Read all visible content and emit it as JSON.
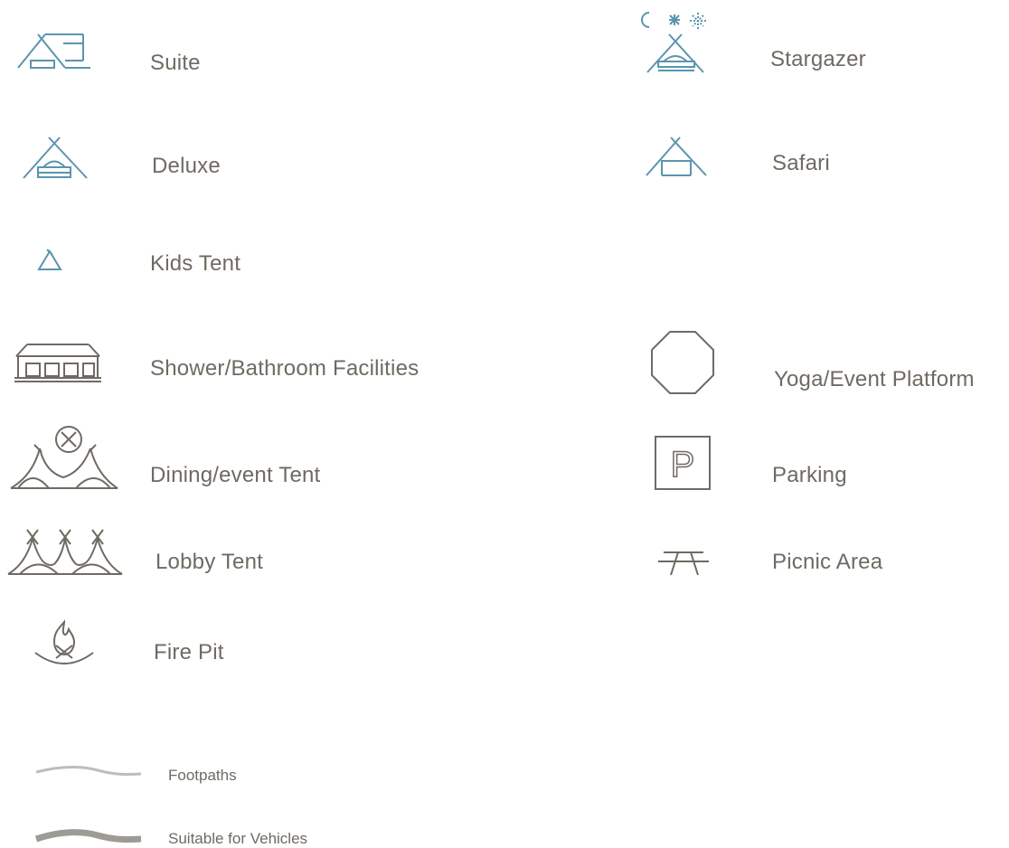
{
  "legend": {
    "left": [
      {
        "label": "Suite",
        "icon": "suite-tent-icon",
        "color": "#5a95ae"
      },
      {
        "label": "Deluxe",
        "icon": "deluxe-tent-icon",
        "color": "#5a95ae"
      },
      {
        "label": "Kids Tent",
        "icon": "kids-tent-icon",
        "color": "#5a95ae"
      },
      {
        "label": "Shower/Bathroom Facilities",
        "icon": "bathroom-building-icon",
        "color": "#6f6a62"
      },
      {
        "label": "Dining/event Tent",
        "icon": "dining-tent-icon",
        "color": "#6f6a62"
      },
      {
        "label": "Lobby Tent",
        "icon": "lobby-tent-icon",
        "color": "#6f6a62"
      },
      {
        "label": "Fire Pit",
        "icon": "fire-pit-icon",
        "color": "#6f6a62"
      }
    ],
    "right": [
      {
        "label": "Stargazer",
        "icon": "stargazer-tent-icon",
        "color": "#5a95ae"
      },
      {
        "label": "Safari",
        "icon": "safari-tent-icon",
        "color": "#5a95ae"
      },
      {
        "label": "Yoga/Event Platform",
        "icon": "octagon-platform-icon",
        "color": "#6f6a62"
      },
      {
        "label": "Parking",
        "icon": "parking-icon",
        "color": "#6f6a62",
        "glyph": "P"
      },
      {
        "label": "Picnic Area",
        "icon": "picnic-table-icon",
        "color": "#6f6a62"
      }
    ],
    "paths": [
      {
        "label": "Footpaths",
        "icon": "footpath-line-icon",
        "color": "#bdbdbd"
      },
      {
        "label": "Suitable for Vehicles",
        "icon": "vehicle-path-line-icon",
        "color": "#9e9a95"
      }
    ]
  }
}
